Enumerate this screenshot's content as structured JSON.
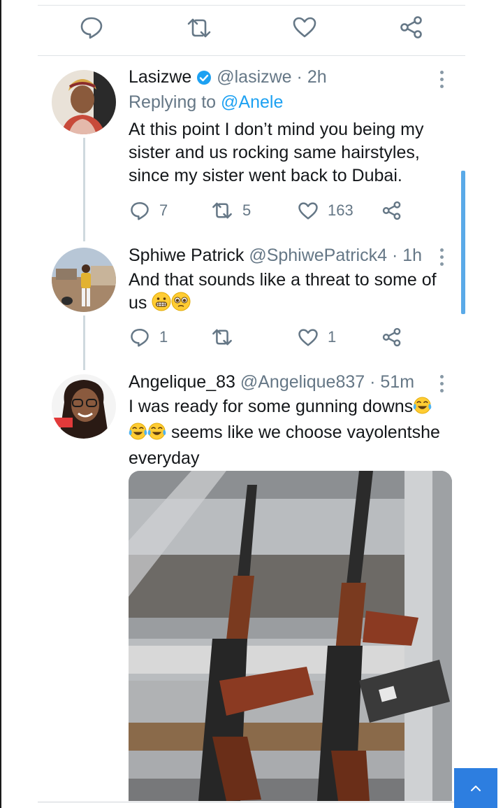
{
  "top_actions": {
    "reply_icon": "speech-bubble-icon",
    "retweet_icon": "retweet-icon",
    "like_icon": "heart-icon",
    "share_icon": "share-icon"
  },
  "tweets": [
    {
      "name": "Lasizwe",
      "verified": true,
      "handle": "@lasizwe",
      "time": "· 2h",
      "replying_label": "Replying to",
      "replying_to": "@Anele",
      "text": "At this point I don’t mind you being my sister and us rocking same hairstyles, since my sister went back to Dubai.",
      "replies": "7",
      "retweets": "5",
      "likes": "163"
    },
    {
      "name": "Sphiwe Patrick",
      "handle": "@SphiwePatrick4",
      "time": "· 1h",
      "text": "And that sounds like a threat to some of us",
      "emojis": [
        "grimacing-face",
        "pleading-face"
      ],
      "replies": "1",
      "retweets": "",
      "likes": "1"
    },
    {
      "name": "Angelique_83",
      "handle": "@Angelique837",
      "time": "· 51m",
      "text_part1": "I was ready for some gunning downs",
      "text_part2": " seems like we choose vayolentshe everyday",
      "emojis": [
        "tears-of-joy",
        "tears-of-joy",
        "tears-of-joy"
      ],
      "media": "photo-of-two-rifles"
    }
  ],
  "colors": {
    "accent": "#1da1f2",
    "icon_gray": "#657786",
    "scroll_button": "#2d7ee0"
  },
  "scroll_to_top_icon": "chevron-up-icon"
}
